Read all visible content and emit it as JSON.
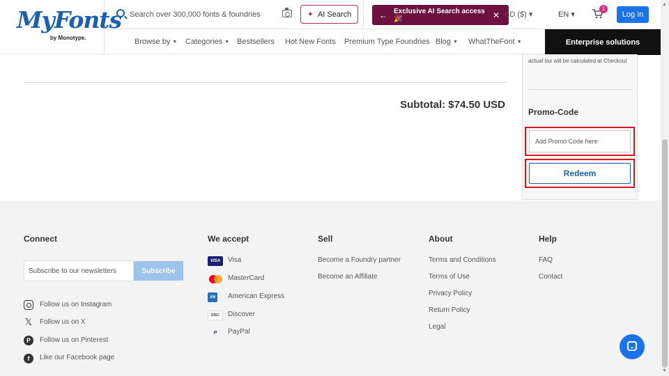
{
  "header": {
    "logo_text": "MyFonts",
    "logo_sub": "by Monotype.",
    "search_placeholder": "Search over 300,000 fonts & foundries",
    "ai_search_label": "AI Search",
    "banner_text": "Exclusive AI Search access 🎉",
    "currency": "SD ($) ▾",
    "language": "EN ▾",
    "cart_count": "1",
    "login_label": "Log In",
    "enterprise_label": "Enterprise solutions",
    "nav": [
      {
        "label": "Browse by",
        "has_caret": true
      },
      {
        "label": "Categories",
        "has_caret": true
      },
      {
        "label": "Bestsellers",
        "has_caret": false
      },
      {
        "label": "Hot New Fonts",
        "has_caret": false
      },
      {
        "label": "Premium Type Foundries",
        "has_caret": false
      },
      {
        "label": "Blog",
        "has_caret": true
      },
      {
        "label": "WhatTheFont",
        "has_caret": true
      }
    ]
  },
  "main": {
    "subtotal": "Subtotal: $74.50 USD"
  },
  "side_panel": {
    "tax_note": "actual tax will be calculated at Checkout",
    "promo_title": "Promo-Code",
    "promo_placeholder": "Add Promo Code here",
    "redeem_label": "Redeem"
  },
  "footer": {
    "connect": {
      "title": "Connect",
      "newsletter_placeholder": "Subscribe to our newsletters",
      "subscribe_label": "Subscribe",
      "social": [
        {
          "icon": "instagram-icon",
          "label": "Follow us on Instagram"
        },
        {
          "icon": "x-icon",
          "label": "Follow us on X"
        },
        {
          "icon": "pinterest-icon",
          "label": "Follow us on Pinterest"
        },
        {
          "icon": "facebook-icon",
          "label": "Like our Facebook page"
        }
      ]
    },
    "accept": {
      "title": "We accept",
      "methods": [
        {
          "icon": "visa-icon",
          "label": "Visa"
        },
        {
          "icon": "mastercard-icon",
          "label": "MasterCard"
        },
        {
          "icon": "amex-icon",
          "label": "American Express"
        },
        {
          "icon": "discover-icon",
          "label": "Discover"
        },
        {
          "icon": "paypal-icon",
          "label": "PayPal"
        }
      ]
    },
    "sell": {
      "title": "Sell",
      "links": [
        "Become a Foundry partner",
        "Become an Affiliate"
      ]
    },
    "about": {
      "title": "About",
      "links": [
        "Terms and Conditions",
        "Terms of Use",
        "Privacy Policy",
        "Return Policy",
        "Legal"
      ]
    },
    "help": {
      "title": "Help",
      "links": [
        "FAQ",
        "Contact"
      ]
    }
  },
  "colors": {
    "brand_blue": "#1a5fb4",
    "login_blue": "#1a73e8",
    "ai_accent": "#b02a6e",
    "banner_bg": "#6d1240",
    "highlight_red": "#e0141f",
    "footer_bg": "#f3f3f3"
  }
}
